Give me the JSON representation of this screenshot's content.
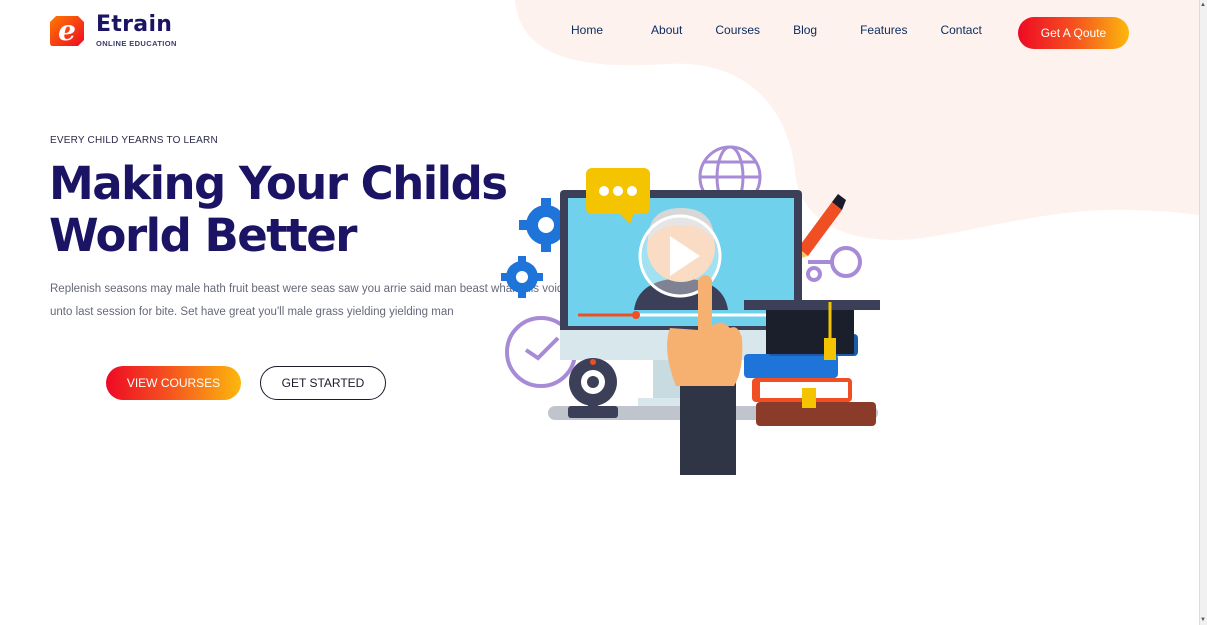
{
  "brand": {
    "name": "Etrain",
    "tagline": "ONLINE EDUCATION"
  },
  "nav": {
    "items": [
      "Home",
      "About",
      "Courses",
      "Blog",
      "Features",
      "Contact"
    ]
  },
  "header": {
    "quote_label": "Get A Qoute"
  },
  "hero": {
    "eyebrow": "EVERY CHILD YEARNS TO LEARN",
    "headline_line1": "Making Your Childs",
    "headline_line2": "World Better",
    "lede": "Replenish seasons may male hath fruit beast were seas saw you arrie said man beast whale his void unto last session for bite. Set have great you'll male grass yielding yielding man",
    "primary_button": "VIEW COURSES",
    "secondary_button": "GET STARTED"
  },
  "colors": {
    "brand_navy": "#1b1464",
    "gradient_start": "#ee0a24",
    "gradient_end": "#fcb80d",
    "blob": "#fdf2ee"
  }
}
